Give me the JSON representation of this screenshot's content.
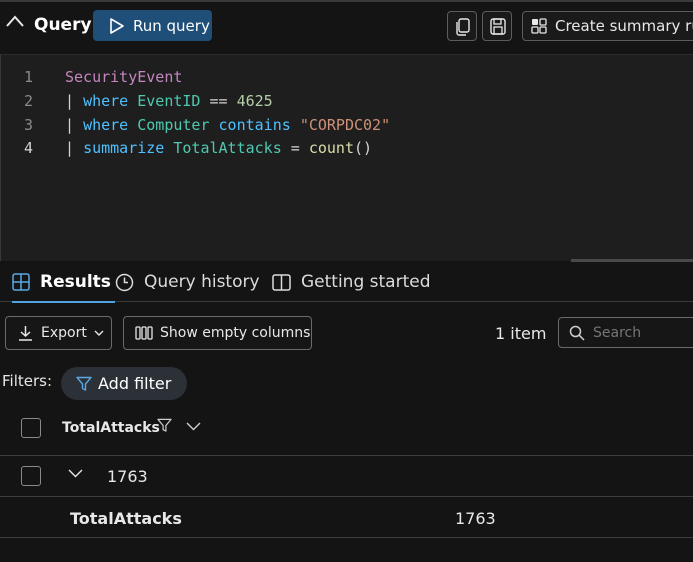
{
  "header": {
    "title": "Query",
    "run_query_label": "Run query",
    "create_summary_rule_label": "Create summary rule"
  },
  "editor": {
    "lines": [
      {
        "number": "1",
        "tokens": [
          {
            "text": "SecurityEvent",
            "color": "#c586c0"
          }
        ]
      },
      {
        "number": "2",
        "tokens": [
          {
            "text": "| ",
            "color": "#d4d4d4"
          },
          {
            "text": "where ",
            "color": "#4fc1ff"
          },
          {
            "text": "EventID",
            "color": "#4ec9b0"
          },
          {
            "text": " == ",
            "color": "#d4d4d4"
          },
          {
            "text": "4625",
            "color": "#b5cea8"
          }
        ]
      },
      {
        "number": "3",
        "tokens": [
          {
            "text": "| ",
            "color": "#d4d4d4"
          },
          {
            "text": "where ",
            "color": "#4fc1ff"
          },
          {
            "text": "Computer",
            "color": "#4ec9b0"
          },
          {
            "text": " contains ",
            "color": "#4fc1ff"
          },
          {
            "text": "\"CORPDC02\"",
            "color": "#ce9178"
          }
        ]
      },
      {
        "number": "4",
        "tokens": [
          {
            "text": "| ",
            "color": "#d4d4d4"
          },
          {
            "text": "summarize ",
            "color": "#4fc1ff"
          },
          {
            "text": "TotalAttacks",
            "color": "#4ec9b0"
          },
          {
            "text": " = ",
            "color": "#d4d4d4"
          },
          {
            "text": "count",
            "color": "#dcdcaa"
          },
          {
            "text": "()",
            "color": "#d4d4d4"
          }
        ]
      }
    ]
  },
  "tabs": {
    "results": "Results",
    "query_history": "Query history",
    "getting_started": "Getting started"
  },
  "toolbar": {
    "export_label": "Export",
    "show_empty_columns_label": "Show empty columns",
    "item_count": "1 item",
    "search_placeholder": "Search"
  },
  "filters": {
    "label": "Filters:",
    "add_filter_label": "Add filter"
  },
  "table": {
    "column_header": "TotalAttacks",
    "group_value": "1763",
    "detail_label": "TotalAttacks",
    "detail_value": "1763"
  }
}
